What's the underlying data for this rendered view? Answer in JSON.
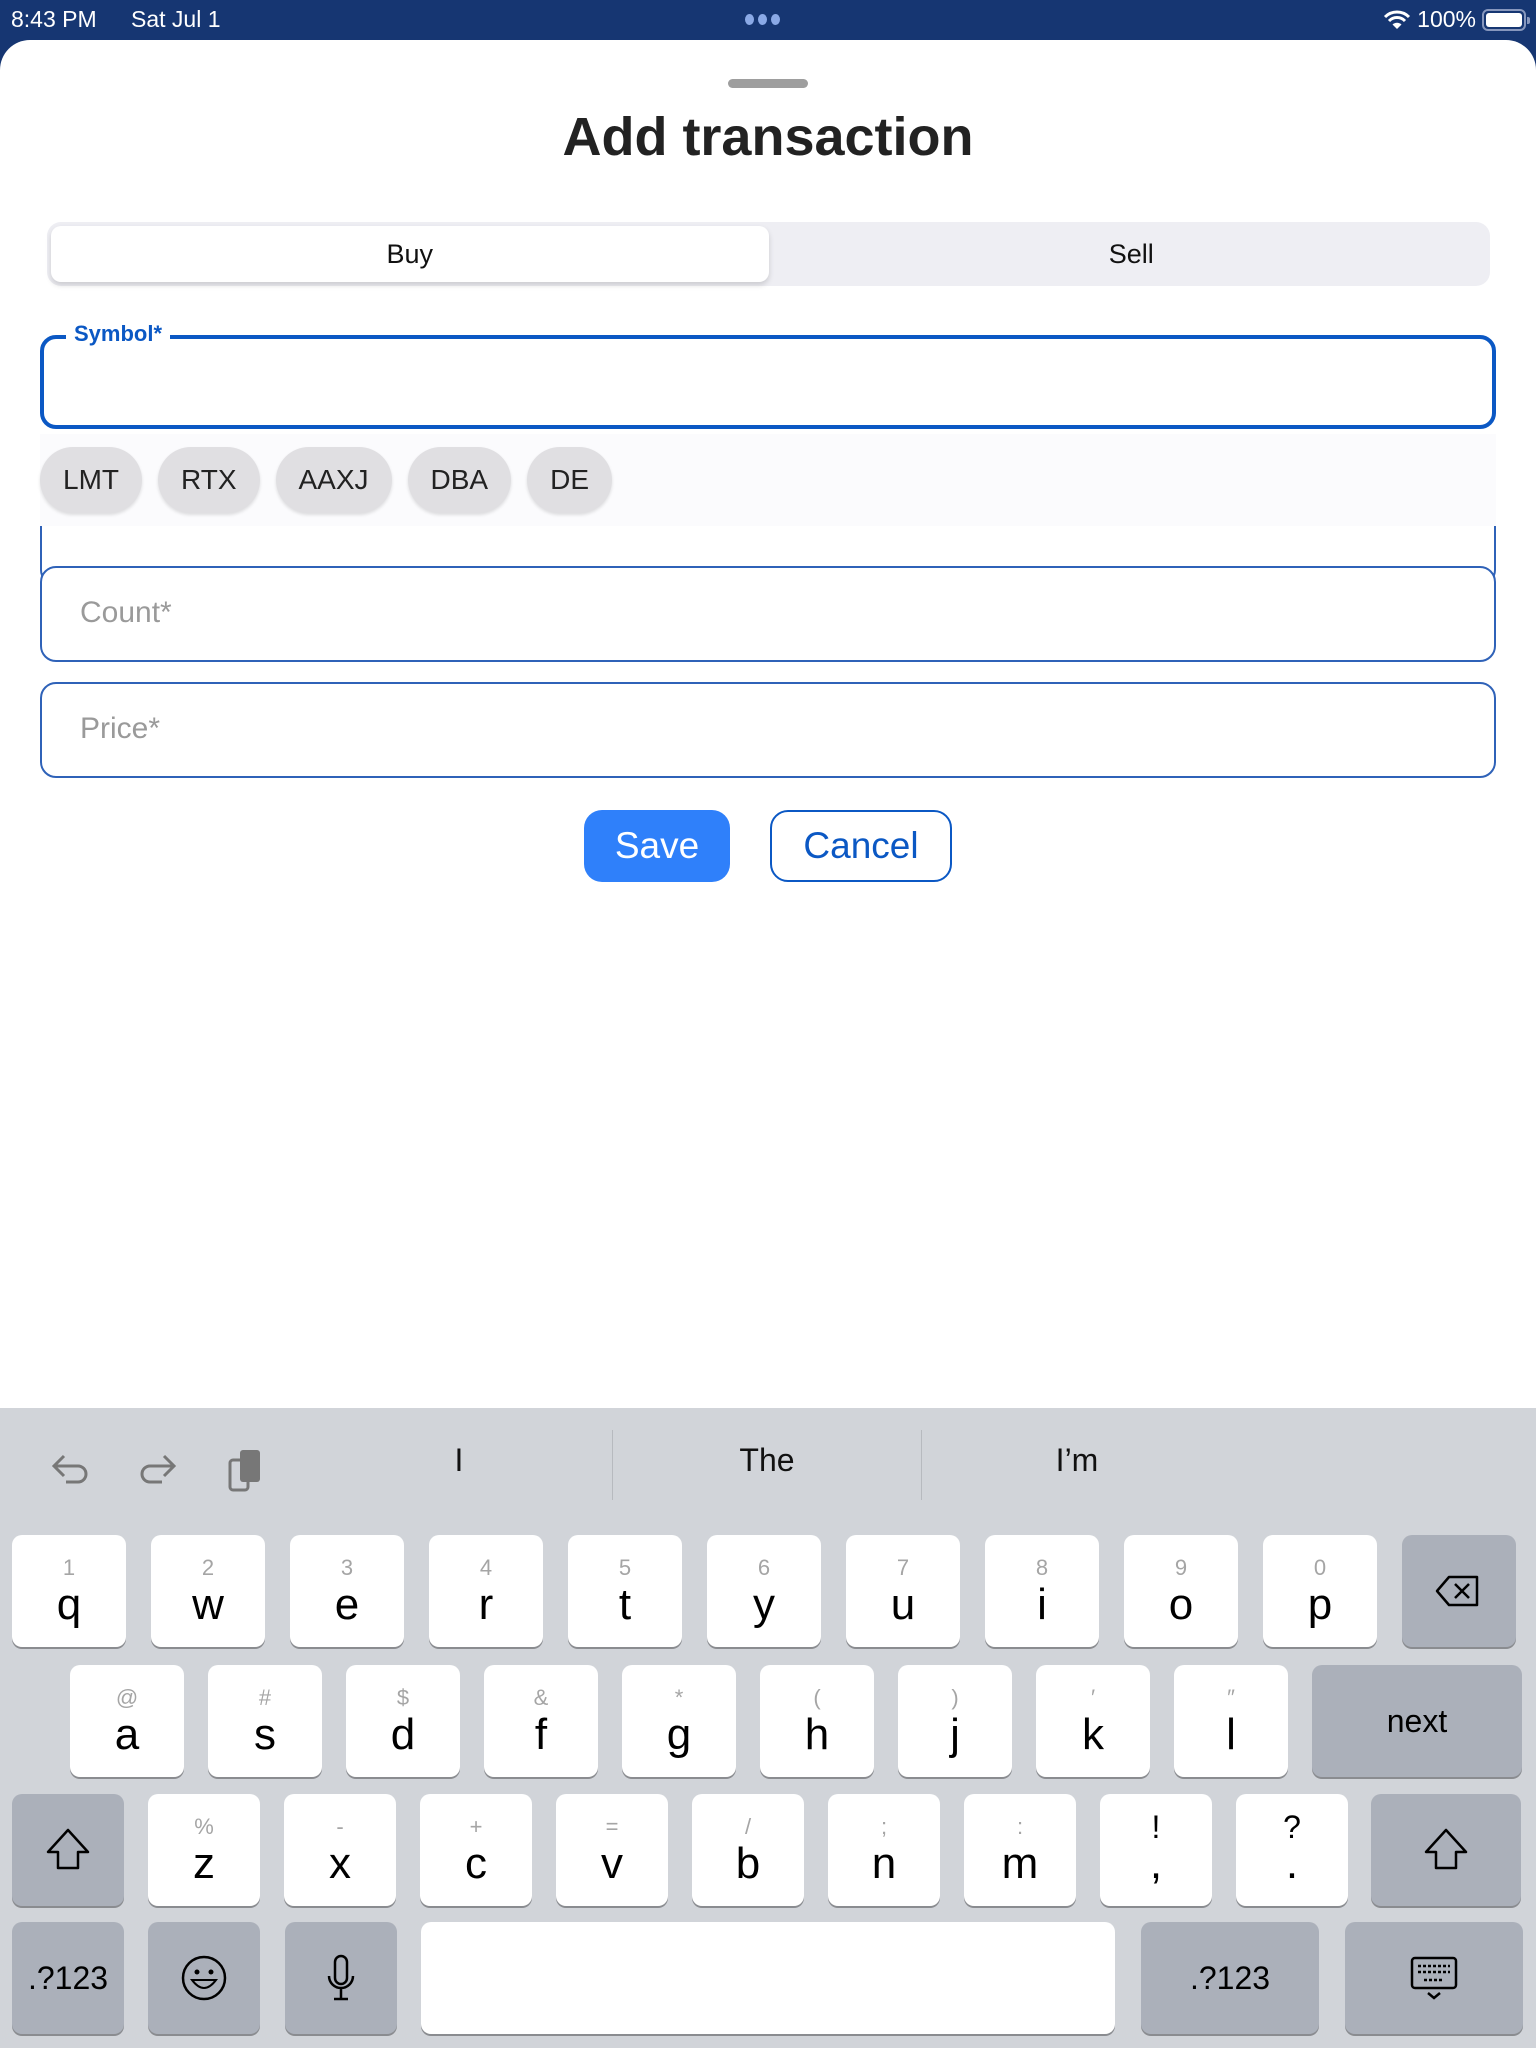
{
  "status_bar": {
    "time": "8:43 PM",
    "date": "Sat Jul 1",
    "battery": "100%",
    "icons": [
      "multitasking-dots-icon",
      "wifi-icon",
      "battery-icon"
    ]
  },
  "sheet": {
    "title": "Add transaction",
    "segments": [
      {
        "label": "Buy",
        "selected": true
      },
      {
        "label": "Sell",
        "selected": false
      }
    ],
    "symbol_field": {
      "label": "Symbol*",
      "value": ""
    },
    "symbol_suggestions": [
      "LMT",
      "RTX",
      "AAXJ",
      "DBA",
      "DE"
    ],
    "count_field": {
      "placeholder": "Count*",
      "value": ""
    },
    "price_field": {
      "placeholder": "Price*",
      "value": ""
    },
    "save_label": "Save",
    "cancel_label": "Cancel"
  },
  "colors": {
    "accent": "#0b58c4",
    "save_button": "#2f80fa",
    "status_bar_bg": "#163672"
  },
  "keyboard": {
    "toolbar_icons": [
      "undo-icon",
      "redo-icon",
      "clipboard-icon"
    ],
    "suggestions": [
      "I",
      "The",
      "I’m"
    ],
    "row1": [
      {
        "sec": "1",
        "pri": "q"
      },
      {
        "sec": "2",
        "pri": "w"
      },
      {
        "sec": "3",
        "pri": "e"
      },
      {
        "sec": "4",
        "pri": "r"
      },
      {
        "sec": "5",
        "pri": "t"
      },
      {
        "sec": "6",
        "pri": "y"
      },
      {
        "sec": "7",
        "pri": "u"
      },
      {
        "sec": "8",
        "pri": "i"
      },
      {
        "sec": "9",
        "pri": "o"
      },
      {
        "sec": "0",
        "pri": "p"
      }
    ],
    "row2": [
      {
        "sec": "@",
        "pri": "a"
      },
      {
        "sec": "#",
        "pri": "s"
      },
      {
        "sec": "$",
        "pri": "d"
      },
      {
        "sec": "&",
        "pri": "f"
      },
      {
        "sec": "*",
        "pri": "g"
      },
      {
        "sec": "(",
        "pri": "h"
      },
      {
        "sec": ")",
        "pri": "j"
      },
      {
        "sec": "′",
        "pri": "k"
      },
      {
        "sec": "″",
        "pri": "l"
      }
    ],
    "row3": [
      {
        "sec": "%",
        "pri": "z"
      },
      {
        "sec": "-",
        "pri": "x"
      },
      {
        "sec": "+",
        "pri": "c"
      },
      {
        "sec": "=",
        "pri": "v"
      },
      {
        "sec": "/",
        "pri": "b"
      },
      {
        "sec": ";",
        "pri": "n"
      },
      {
        "sec": ":",
        "pri": "m"
      },
      {
        "sec": "!",
        "pri": ","
      },
      {
        "sec": "?",
        "pri": "."
      }
    ],
    "next_label": "next",
    "numbers_label": ".?123"
  }
}
